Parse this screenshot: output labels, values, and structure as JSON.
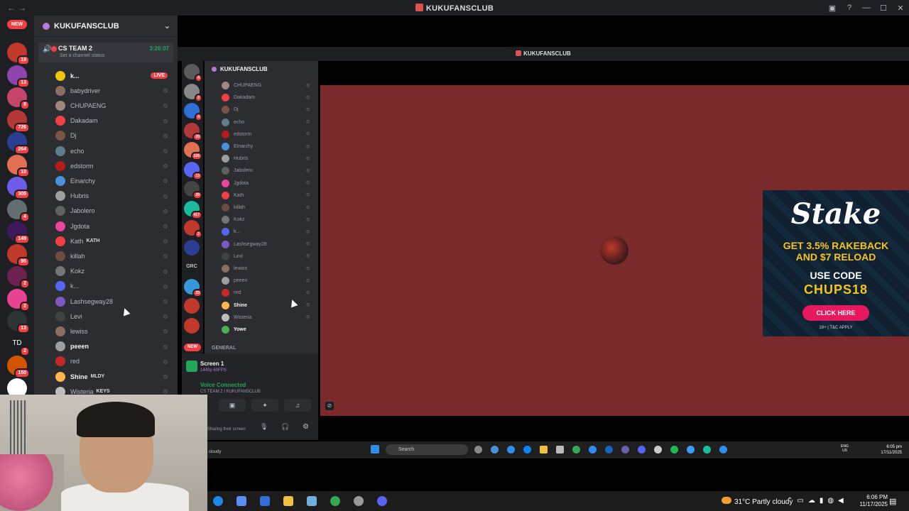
{
  "app": {
    "title": "KUKUFANSCLUB"
  },
  "rail": {
    "new_label": "NEW",
    "servers": [
      {
        "badge": "19",
        "color": "#c0392b"
      },
      {
        "badge": "13",
        "color": "#8e44ad"
      },
      {
        "badge": "8",
        "color": "#c44569"
      },
      {
        "badge": "726",
        "color": "#b33939"
      },
      {
        "badge": "264",
        "color": "#2c3e92"
      },
      {
        "badge": "10",
        "color": "#e17055"
      },
      {
        "badge": "305",
        "color": "#6c5ce7"
      },
      {
        "badge": "4",
        "color": "#636e72"
      },
      {
        "badge": "149",
        "color": "#3c1a5b"
      },
      {
        "badge": "95",
        "color": "#c0392b"
      },
      {
        "badge": "2",
        "color": "#6d214f"
      },
      {
        "badge": "2",
        "color": "#e84393"
      },
      {
        "badge": "13",
        "color": "#2d3436"
      },
      {
        "badge": "2",
        "color": "#1e1f22",
        "label": "TD"
      },
      {
        "badge": "150",
        "color": "#d35400"
      },
      {
        "badge": "",
        "color": "#ffffff"
      },
      {
        "badge": "",
        "color": "#b33939"
      }
    ]
  },
  "sidebar": {
    "server_name": "KUKUFANSCLUB",
    "voice_channel": {
      "name": "CS TEAM 2",
      "status": "Set a channel status",
      "timer": "3:26:07"
    },
    "members": [
      {
        "name": "k...",
        "live": "LIVE",
        "bold": true,
        "color": "#f1c40f"
      },
      {
        "name": "babydriver",
        "color": "#8d6e63"
      },
      {
        "name": "CHUPAENG",
        "color": "#a1887f"
      },
      {
        "name": "Dakadam",
        "color": "#f23f43"
      },
      {
        "name": "Dj",
        "color": "#795548"
      },
      {
        "name": "echo",
        "color": "#607d8b"
      },
      {
        "name": "edstorm",
        "color": "#b71c1c"
      },
      {
        "name": "Einarchy",
        "color": "#4a90d9"
      },
      {
        "name": "Hubris",
        "color": "#9e9e9e"
      },
      {
        "name": "Jabolero",
        "color": "#616161"
      },
      {
        "name": "Jgdota",
        "color": "#eb459e"
      },
      {
        "name": "Kath",
        "tag": "KATH",
        "color": "#f23f43"
      },
      {
        "name": "killah",
        "color": "#6d4c41"
      },
      {
        "name": "Kokz",
        "color": "#757575"
      },
      {
        "name": "k...",
        "color": "#5865f2"
      },
      {
        "name": "Lashsegway28",
        "color": "#7e57c2"
      },
      {
        "name": "Levi",
        "color": "#424242"
      },
      {
        "name": "lewiss",
        "color": "#8d6e63"
      },
      {
        "name": "peeen",
        "bold": true,
        "color": "#9e9e9e"
      },
      {
        "name": "red",
        "color": "#c62828"
      },
      {
        "name": "Shine",
        "tag": "MLDY",
        "bold": true,
        "color": "#ffb74d"
      },
      {
        "name": "Wisteria",
        "tag": "KEYS",
        "color": "#bdbdbd"
      }
    ]
  },
  "inner": {
    "title": "KUKUFANSCLUB",
    "server_name": "KUKUFANSCLUB",
    "new_label": "NEW",
    "rail_badges": [
      "4",
      "2",
      "4",
      "20",
      "226",
      "13",
      "29",
      "417",
      "2",
      "",
      "GRC",
      "33",
      "",
      ""
    ],
    "members": [
      "CHUPAENG",
      "Dakadam",
      "Dj",
      "echo",
      "edstorm",
      "Einarchy",
      "Hubris",
      "Jabolero",
      "Jgdota",
      "Kath",
      "killah",
      "Kokz",
      "k...",
      "Lashsegway28",
      "Levi",
      "lewiss",
      "peeen",
      "red",
      "Shine",
      "Wisteria",
      "Yowe"
    ],
    "category": "GENERAL",
    "screen_title": "Screen 1",
    "screen_sub": "1440p 60FPS",
    "voice_connected": "Voice Connected",
    "voice_sub": "CS TEAM 2 / KUKUFANSCLUB",
    "sharing": "Sharing their screen",
    "weather_short": "cloudy",
    "search": "Search",
    "lang": "ENG\nUS",
    "time": "6:05 pm",
    "date": "17/11/2025"
  },
  "ad": {
    "brand": "Stake",
    "line1": "GET 3.5% RAKEBACK",
    "line1b": "AND $7 RELOAD",
    "line2": "USE CODE",
    "code": "CHUPS18",
    "cta": "CLICK HERE",
    "legal": "18+ | T&C APPLY"
  },
  "taskbar": {
    "weather": "31°C  Partly cloudy",
    "time": "6:06 PM",
    "date": "11/17/2025"
  }
}
